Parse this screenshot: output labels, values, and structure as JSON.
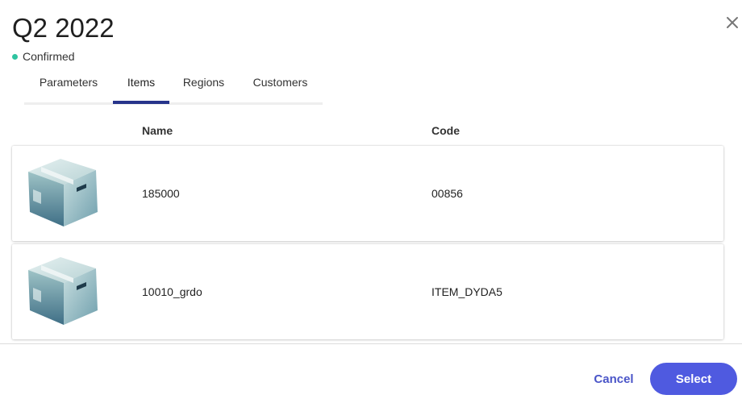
{
  "dialog": {
    "title": "Q2 2022",
    "status": {
      "text": "Confirmed",
      "color": "#2ec4a0"
    },
    "close_icon": "close-icon"
  },
  "tabs": [
    {
      "label": "Parameters",
      "active": false
    },
    {
      "label": "Items",
      "active": true
    },
    {
      "label": "Regions",
      "active": false
    },
    {
      "label": "Customers",
      "active": false
    }
  ],
  "table": {
    "columns": [
      "Name",
      "Code"
    ],
    "rows": [
      {
        "icon": "box-icon",
        "name": "185000",
        "code": "00856"
      },
      {
        "icon": "box-icon",
        "name": "10010_grdo",
        "code": "ITEM_DYDA5"
      }
    ]
  },
  "footer": {
    "cancel_label": "Cancel",
    "select_label": "Select"
  },
  "colors": {
    "accent": "#4f5ae0",
    "tab_underline": "#27348b",
    "status": "#2ec4a0"
  }
}
